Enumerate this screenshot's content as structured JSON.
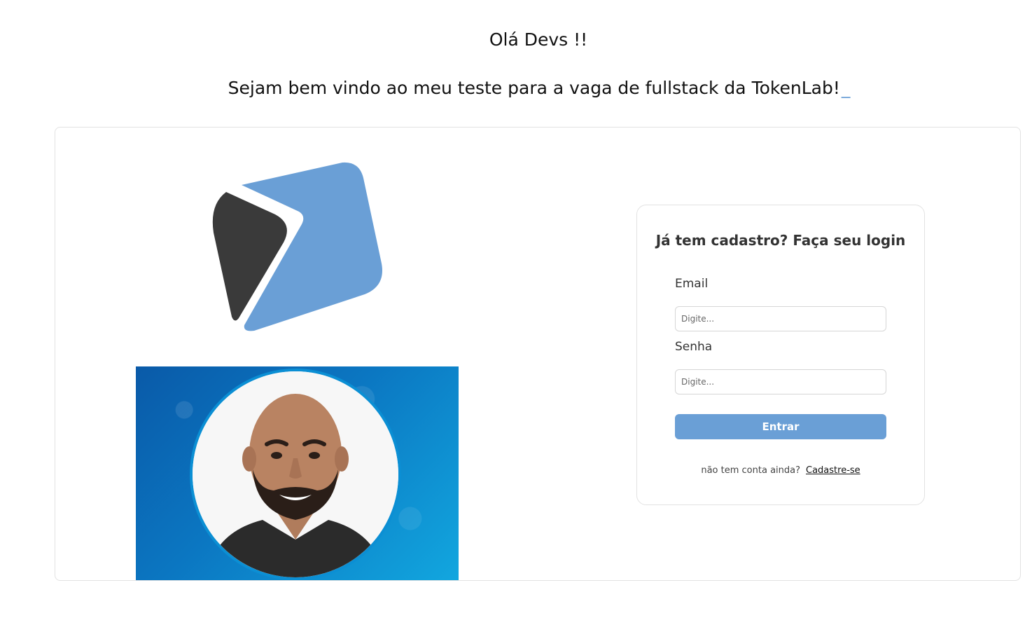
{
  "header": {
    "greeting": "Olá Devs !!",
    "welcome": "Sejam bem vindo ao meu teste para a vaga de fullstack da TokenLab!",
    "cursor": "_"
  },
  "colors": {
    "accent": "#6a9fd6",
    "logo_dark": "#3a3a3a",
    "logo_blue": "#6a9fd6",
    "photo_blue": "#0b77c2"
  },
  "icons": {
    "logo": "tokenlab-logo",
    "photo": "developer-avatar-photo"
  },
  "login": {
    "title": "Já tem cadastro? Faça seu login",
    "email_label": "Email",
    "email_placeholder": "Digite...",
    "email_value": "",
    "password_label": "Senha",
    "password_placeholder": "Digite...",
    "password_value": "",
    "submit_label": "Entrar",
    "no_account_text": "não tem conta ainda?",
    "signup_link": "Cadastre-se"
  }
}
